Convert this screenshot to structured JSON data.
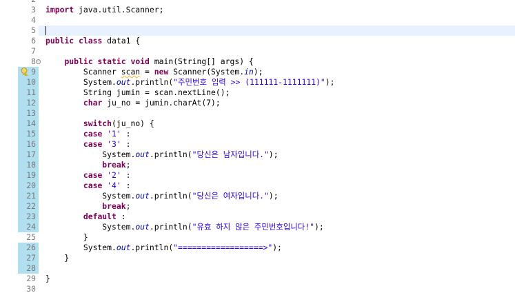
{
  "editor": {
    "lines": [
      {
        "num": "2",
        "mod": false,
        "current": false,
        "fold": false,
        "marker": false,
        "tokens": []
      },
      {
        "num": "3",
        "mod": false,
        "current": false,
        "fold": false,
        "marker": false,
        "tokens": [
          {
            "t": "import",
            "c": "kw"
          },
          {
            "t": " java.util.Scanner;",
            "c": ""
          }
        ]
      },
      {
        "num": "4",
        "mod": false,
        "current": false,
        "fold": false,
        "marker": false,
        "tokens": []
      },
      {
        "num": "5",
        "mod": false,
        "current": true,
        "fold": false,
        "marker": false,
        "caret": true,
        "tokens": []
      },
      {
        "num": "6",
        "mod": false,
        "current": false,
        "fold": false,
        "marker": false,
        "tokens": [
          {
            "t": "public",
            "c": "kw"
          },
          {
            "t": " ",
            "c": ""
          },
          {
            "t": "class",
            "c": "kw"
          },
          {
            "t": " data1 {",
            "c": ""
          }
        ]
      },
      {
        "num": "7",
        "mod": false,
        "current": false,
        "fold": false,
        "marker": false,
        "tokens": []
      },
      {
        "num": "8",
        "mod": false,
        "current": false,
        "fold": true,
        "marker": false,
        "tokens": [
          {
            "t": "    ",
            "c": ""
          },
          {
            "t": "public",
            "c": "kw"
          },
          {
            "t": " ",
            "c": ""
          },
          {
            "t": "static",
            "c": "kw"
          },
          {
            "t": " ",
            "c": ""
          },
          {
            "t": "void",
            "c": "kw"
          },
          {
            "t": " main(String[] args) {",
            "c": ""
          }
        ]
      },
      {
        "num": "9",
        "mod": true,
        "current": false,
        "fold": false,
        "marker": true,
        "tokens": [
          {
            "t": "        Scanner ",
            "c": ""
          },
          {
            "t": "scan",
            "c": "warn"
          },
          {
            "t": " = ",
            "c": ""
          },
          {
            "t": "new",
            "c": "kw"
          },
          {
            "t": " Scanner(System.",
            "c": ""
          },
          {
            "t": "in",
            "c": "fld"
          },
          {
            "t": ");",
            "c": ""
          }
        ]
      },
      {
        "num": "10",
        "mod": true,
        "current": false,
        "fold": false,
        "marker": false,
        "tokens": [
          {
            "t": "        System.",
            "c": ""
          },
          {
            "t": "out",
            "c": "fld"
          },
          {
            "t": ".println(",
            "c": ""
          },
          {
            "t": "\"주민번호 입력 >> (111111-1111111)\"",
            "c": "str"
          },
          {
            "t": ");",
            "c": ""
          }
        ]
      },
      {
        "num": "11",
        "mod": true,
        "current": false,
        "fold": false,
        "marker": false,
        "tokens": [
          {
            "t": "        String jumin = scan.nextLine();",
            "c": ""
          }
        ]
      },
      {
        "num": "12",
        "mod": true,
        "current": false,
        "fold": false,
        "marker": false,
        "tokens": [
          {
            "t": "        ",
            "c": ""
          },
          {
            "t": "char",
            "c": "kw"
          },
          {
            "t": " ju_no = jumin.charAt(7);",
            "c": ""
          }
        ]
      },
      {
        "num": "13",
        "mod": true,
        "current": false,
        "fold": false,
        "marker": false,
        "tokens": []
      },
      {
        "num": "14",
        "mod": true,
        "current": false,
        "fold": false,
        "marker": false,
        "tokens": [
          {
            "t": "        ",
            "c": ""
          },
          {
            "t": "switch",
            "c": "kw"
          },
          {
            "t": "(ju_no) {",
            "c": ""
          }
        ]
      },
      {
        "num": "15",
        "mod": true,
        "current": false,
        "fold": false,
        "marker": false,
        "tokens": [
          {
            "t": "        ",
            "c": ""
          },
          {
            "t": "case",
            "c": "kw"
          },
          {
            "t": " ",
            "c": ""
          },
          {
            "t": "'1'",
            "c": "str"
          },
          {
            "t": " :",
            "c": ""
          }
        ]
      },
      {
        "num": "16",
        "mod": true,
        "current": false,
        "fold": false,
        "marker": false,
        "tokens": [
          {
            "t": "        ",
            "c": ""
          },
          {
            "t": "case",
            "c": "kw"
          },
          {
            "t": " ",
            "c": ""
          },
          {
            "t": "'3'",
            "c": "str"
          },
          {
            "t": " :",
            "c": ""
          }
        ]
      },
      {
        "num": "17",
        "mod": true,
        "current": false,
        "fold": false,
        "marker": false,
        "tokens": [
          {
            "t": "            System.",
            "c": ""
          },
          {
            "t": "out",
            "c": "fld"
          },
          {
            "t": ".println(",
            "c": ""
          },
          {
            "t": "\"당신은 남자입니다.\"",
            "c": "str"
          },
          {
            "t": ");",
            "c": ""
          }
        ]
      },
      {
        "num": "18",
        "mod": true,
        "current": false,
        "fold": false,
        "marker": false,
        "tokens": [
          {
            "t": "            ",
            "c": ""
          },
          {
            "t": "break",
            "c": "kw"
          },
          {
            "t": ";",
            "c": ""
          }
        ]
      },
      {
        "num": "19",
        "mod": true,
        "current": false,
        "fold": false,
        "marker": false,
        "tokens": [
          {
            "t": "        ",
            "c": ""
          },
          {
            "t": "case",
            "c": "kw"
          },
          {
            "t": " ",
            "c": ""
          },
          {
            "t": "'2'",
            "c": "str"
          },
          {
            "t": " :",
            "c": ""
          }
        ]
      },
      {
        "num": "20",
        "mod": true,
        "current": false,
        "fold": false,
        "marker": false,
        "tokens": [
          {
            "t": "        ",
            "c": ""
          },
          {
            "t": "case",
            "c": "kw"
          },
          {
            "t": " ",
            "c": ""
          },
          {
            "t": "'4'",
            "c": "str"
          },
          {
            "t": " :",
            "c": ""
          }
        ]
      },
      {
        "num": "21",
        "mod": true,
        "current": false,
        "fold": false,
        "marker": false,
        "tokens": [
          {
            "t": "            System.",
            "c": ""
          },
          {
            "t": "out",
            "c": "fld"
          },
          {
            "t": ".println(",
            "c": ""
          },
          {
            "t": "\"당신은 여자입니다.\"",
            "c": "str"
          },
          {
            "t": ");",
            "c": ""
          }
        ]
      },
      {
        "num": "22",
        "mod": true,
        "current": false,
        "fold": false,
        "marker": false,
        "tokens": [
          {
            "t": "            ",
            "c": ""
          },
          {
            "t": "break",
            "c": "kw"
          },
          {
            "t": ";",
            "c": ""
          }
        ]
      },
      {
        "num": "23",
        "mod": true,
        "current": false,
        "fold": false,
        "marker": false,
        "tokens": [
          {
            "t": "        ",
            "c": ""
          },
          {
            "t": "default",
            "c": "kw"
          },
          {
            "t": " :",
            "c": ""
          }
        ]
      },
      {
        "num": "24",
        "mod": true,
        "current": false,
        "fold": false,
        "marker": false,
        "tokens": [
          {
            "t": "            System.",
            "c": ""
          },
          {
            "t": "out",
            "c": "fld"
          },
          {
            "t": ".println(",
            "c": ""
          },
          {
            "t": "\"유효 하지 않은 주민번호입니다!\"",
            "c": "str"
          },
          {
            "t": ");",
            "c": ""
          }
        ]
      },
      {
        "num": "25",
        "mod": false,
        "current": false,
        "fold": false,
        "marker": false,
        "tokens": [
          {
            "t": "        }",
            "c": ""
          }
        ]
      },
      {
        "num": "26",
        "mod": true,
        "current": false,
        "fold": false,
        "marker": false,
        "tokens": [
          {
            "t": "        System.",
            "c": ""
          },
          {
            "t": "out",
            "c": "fld"
          },
          {
            "t": ".println(",
            "c": ""
          },
          {
            "t": "\"==================>\"",
            "c": "str"
          },
          {
            "t": ");",
            "c": ""
          }
        ]
      },
      {
        "num": "27",
        "mod": true,
        "current": false,
        "fold": false,
        "marker": false,
        "tokens": [
          {
            "t": "    }",
            "c": ""
          }
        ]
      },
      {
        "num": "28",
        "mod": true,
        "current": false,
        "fold": false,
        "marker": false,
        "tokens": []
      },
      {
        "num": "29",
        "mod": false,
        "current": false,
        "fold": false,
        "marker": false,
        "tokens": [
          {
            "t": "}",
            "c": ""
          }
        ]
      },
      {
        "num": "30",
        "mod": false,
        "current": false,
        "fold": false,
        "marker": false,
        "tokens": []
      }
    ]
  }
}
